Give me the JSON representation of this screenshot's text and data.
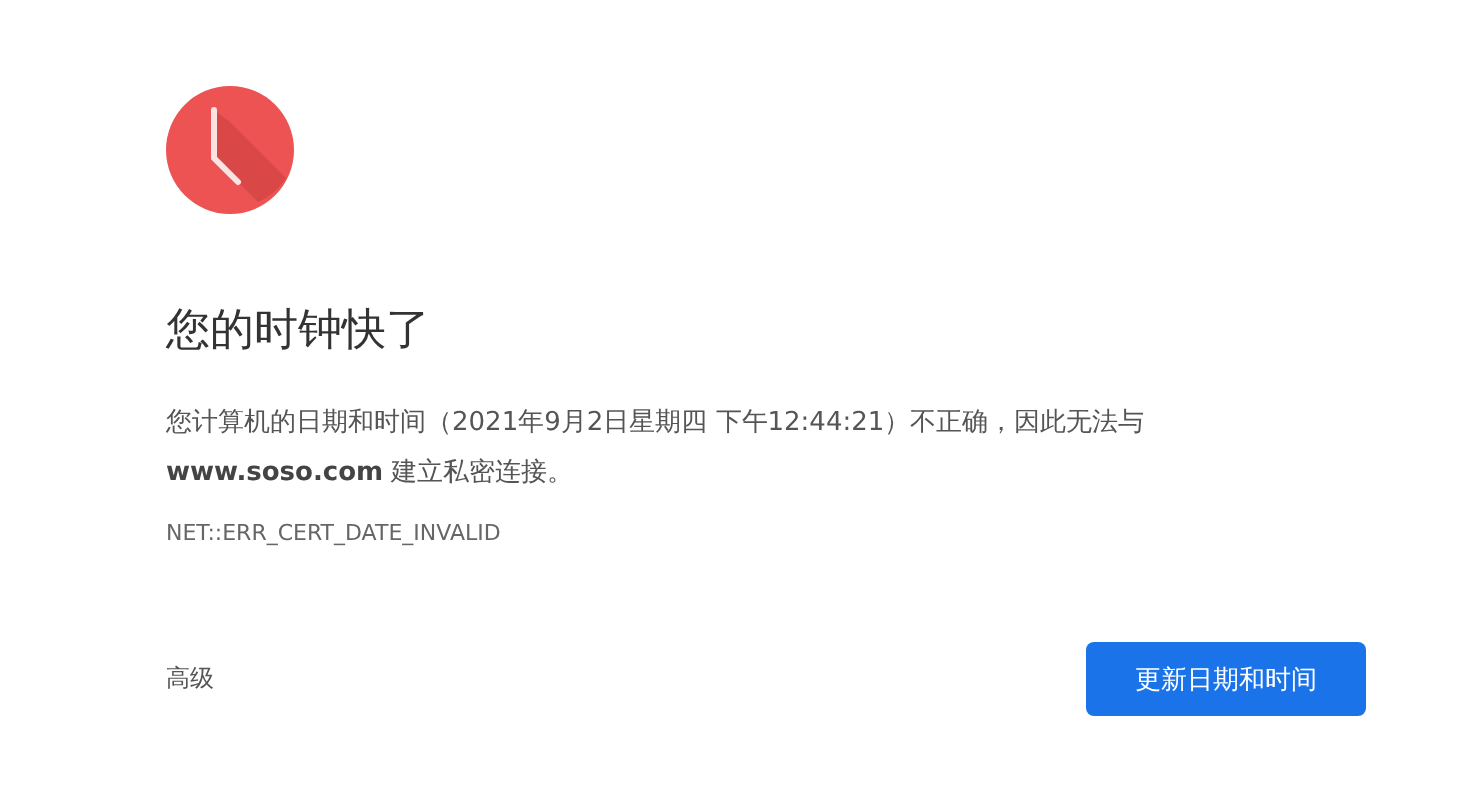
{
  "heading": "您的时钟快了",
  "message": "您计算机的日期和时间（2021年9月2日星期四 下午12:44:21）不正确，因此无法与 **www.soso.com** 建立私密连接。",
  "error_code": "NET::ERR_CERT_DATE_INVALID",
  "advanced_link": "高级",
  "primary_button": "更新日期和时间"
}
